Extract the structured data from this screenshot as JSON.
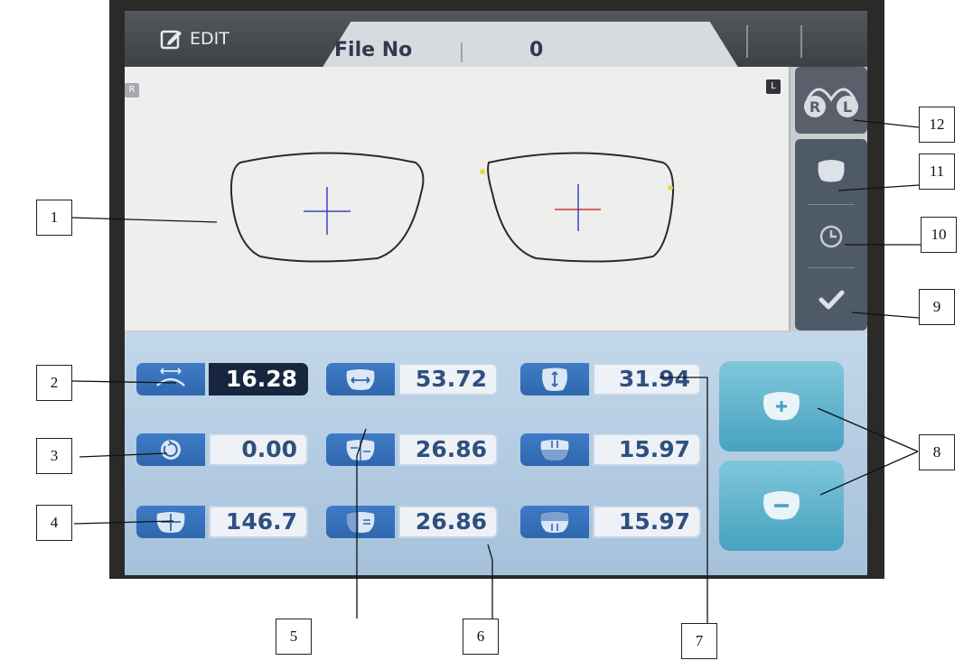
{
  "header": {
    "edit_label": "EDIT",
    "file_label": "File No",
    "file_value": "0"
  },
  "lens_area": {
    "right_badge": "R",
    "left_badge": "L"
  },
  "side_panel": {
    "rl_label_r": "R",
    "rl_label_l": "L"
  },
  "measurements": {
    "bridge": "16.28",
    "frame_width": "53.72",
    "frame_height": "31.94",
    "rotation": "0.00",
    "half_width_inner": "26.86",
    "half_height_top": "15.97",
    "total_width": "146.7",
    "half_width_outer": "26.86",
    "half_height_bottom": "15.97"
  },
  "callouts": [
    "1",
    "2",
    "3",
    "4",
    "5",
    "6",
    "7",
    "8",
    "9",
    "10",
    "11",
    "12"
  ],
  "colors": {
    "accent_blue": "#2f67ae",
    "lens_cross_blue": "#3b45c8",
    "lens_cross_red": "#c23a3a",
    "plus_minus_teal": "#47a2c0"
  }
}
